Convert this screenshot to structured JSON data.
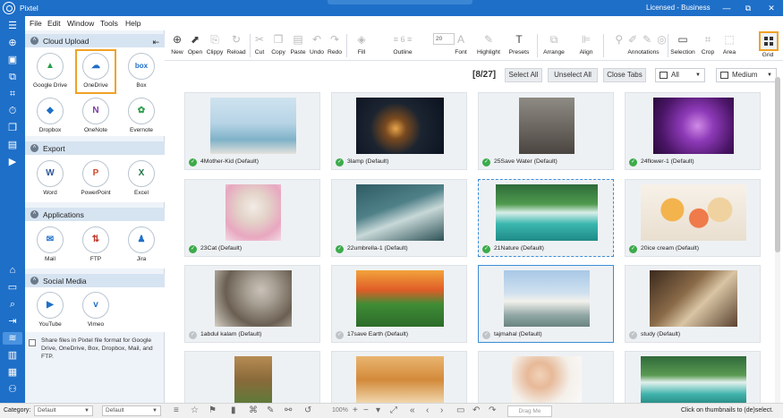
{
  "window": {
    "app_title": "Pixtel",
    "license": "Licensed - Business",
    "min": "—",
    "max": "⧉",
    "close": "✕"
  },
  "menu": [
    "File",
    "Edit",
    "Window",
    "Tools",
    "Help"
  ],
  "panel": {
    "sections": {
      "cloud_upload": "Cloud Upload",
      "export": "Export",
      "applications": "Applications",
      "social_media": "Social Media"
    },
    "cloud": [
      {
        "label": "Google Drive",
        "glyph": "▲",
        "color": "#2a9d4a"
      },
      {
        "label": "OneDrive",
        "glyph": "☁",
        "color": "#1e6fc8"
      },
      {
        "label": "Box",
        "glyph": "box",
        "color": "#1e6fc8"
      },
      {
        "label": "Dropbox",
        "glyph": "◆",
        "color": "#1e6fc8"
      },
      {
        "label": "OneNote",
        "glyph": "N",
        "color": "#7b3aa4"
      },
      {
        "label": "Evernote",
        "glyph": "✿",
        "color": "#2a9d4a"
      }
    ],
    "export": [
      {
        "label": "Word",
        "glyph": "W",
        "color": "#2b579a"
      },
      {
        "label": "PowerPoint",
        "glyph": "P",
        "color": "#d24726"
      },
      {
        "label": "Excel",
        "glyph": "X",
        "color": "#217346"
      }
    ],
    "applications": [
      {
        "label": "Mail",
        "glyph": "✉",
        "color": "#1e6fc8"
      },
      {
        "label": "FTP",
        "glyph": "⇅",
        "color": "#c0392b"
      },
      {
        "label": "Jira",
        "glyph": "♟",
        "color": "#1e6fc8"
      }
    ],
    "social": [
      {
        "label": "YouTube",
        "glyph": "▶",
        "color": "#1e6fc8"
      },
      {
        "label": "Vimeo",
        "glyph": "v",
        "color": "#1e6fc8"
      }
    ],
    "share_note": "Share files in Pixtel file format for Google Drive, OneDrive, Box, Dropbox, Mail, and FTP."
  },
  "ribbon": {
    "new": "New",
    "open": "Open",
    "clippy": "Clippy",
    "reload": "Reload",
    "cut": "Cut",
    "copy": "Copy",
    "paste": "Paste",
    "undo": "Undo",
    "redo": "Redo",
    "fill": "Fill",
    "outline": "Outline",
    "outline_width": "6",
    "font_size": "20",
    "font": "Font",
    "highlight": "Highlight",
    "presets": "Presets",
    "arrange": "Arrange",
    "align": "Align",
    "annotations": "Annotations",
    "selection": "Selection",
    "crop": "Crop",
    "area": "Area",
    "grid": "Grid"
  },
  "toolbar2": {
    "counter": "[8/27]",
    "select_all": "Select All",
    "unselect_all": "Unselect All",
    "close_tabs": "Close Tabs",
    "filter": "All",
    "size": "Medium"
  },
  "thumbnails": [
    {
      "caption": "4Mother-Kid (Default)",
      "checked": true
    },
    {
      "caption": "3lamp (Default)",
      "checked": true
    },
    {
      "caption": "25Save Water (Default)",
      "checked": true
    },
    {
      "caption": "24flower-1 (Default)",
      "checked": true
    },
    {
      "caption": "23Cat (Default)",
      "checked": true
    },
    {
      "caption": "22umbrella-1 (Default)",
      "checked": true
    },
    {
      "caption": "21Nature (Default)",
      "checked": true
    },
    {
      "caption": "20ice cream (Default)",
      "checked": true
    },
    {
      "caption": "1abdul kalam (Default)",
      "checked": false
    },
    {
      "caption": "17save Earth (Default)",
      "checked": false
    },
    {
      "caption": "tajmahal (Default)",
      "checked": false
    },
    {
      "caption": "study (Default)",
      "checked": false
    },
    {
      "caption": "",
      "checked": false
    },
    {
      "caption": "",
      "checked": false
    },
    {
      "caption": "",
      "checked": false
    },
    {
      "caption": "",
      "checked": false
    }
  ],
  "status": {
    "category_label": "Category:",
    "category_value": "Default",
    "second_value": "Default",
    "zoom": "100%",
    "drag_me": "Drag Me",
    "hint": "Click on thumbnails to (de)select."
  }
}
